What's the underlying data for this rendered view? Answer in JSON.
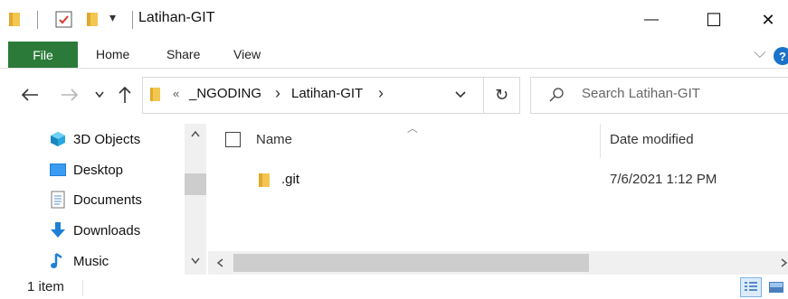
{
  "window": {
    "title": "Latihan-GIT",
    "minimize_glyph": "—",
    "maximize_glyph": "☐",
    "close_glyph": "✕"
  },
  "ribbon": {
    "tabs": [
      "File",
      "Home",
      "Share",
      "View"
    ],
    "expand_glyph": "⌵",
    "help_glyph": "?"
  },
  "address": {
    "overflow_glyph": "«",
    "crumbs": [
      "_NGODING",
      "Latihan-GIT"
    ],
    "separator": "›",
    "dropdown_glyph": "⌄",
    "refresh_glyph": "↻"
  },
  "search": {
    "placeholder": "Search Latihan-GIT"
  },
  "nav_pane": {
    "items": [
      {
        "label": "3D Objects",
        "icon": "3d-objects-icon"
      },
      {
        "label": "Desktop",
        "icon": "desktop-icon"
      },
      {
        "label": "Documents",
        "icon": "documents-icon"
      },
      {
        "label": "Downloads",
        "icon": "downloads-icon"
      },
      {
        "label": "Music",
        "icon": "music-icon"
      }
    ]
  },
  "file_list": {
    "columns": {
      "name": "Name",
      "date": "Date modified"
    },
    "rows": [
      {
        "name": ".git",
        "date": "7/6/2021 1:12 PM",
        "icon": "folder-icon"
      }
    ]
  },
  "status": {
    "item_count": "1 item"
  },
  "colors": {
    "file_tab": "#2b7a3a",
    "folder": "#f3c64f",
    "accent_blue": "#1a73c9"
  }
}
